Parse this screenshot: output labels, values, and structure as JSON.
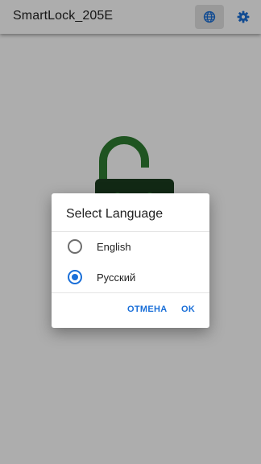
{
  "app": {
    "title": "SmartLock_205E",
    "icons": {
      "language": "globe-icon",
      "settings": "gear-icon"
    },
    "accent_color": "#1a6fd8"
  },
  "main": {
    "lock_icon": "open-padlock-icon",
    "lock_color": "#2e7d32",
    "status_text": ""
  },
  "dialog": {
    "title": "Select Language",
    "options": [
      {
        "label": "English",
        "selected": false
      },
      {
        "label": "Русский",
        "selected": true
      }
    ],
    "cancel_label": "ОТМЕНА",
    "ok_label": "OK"
  }
}
